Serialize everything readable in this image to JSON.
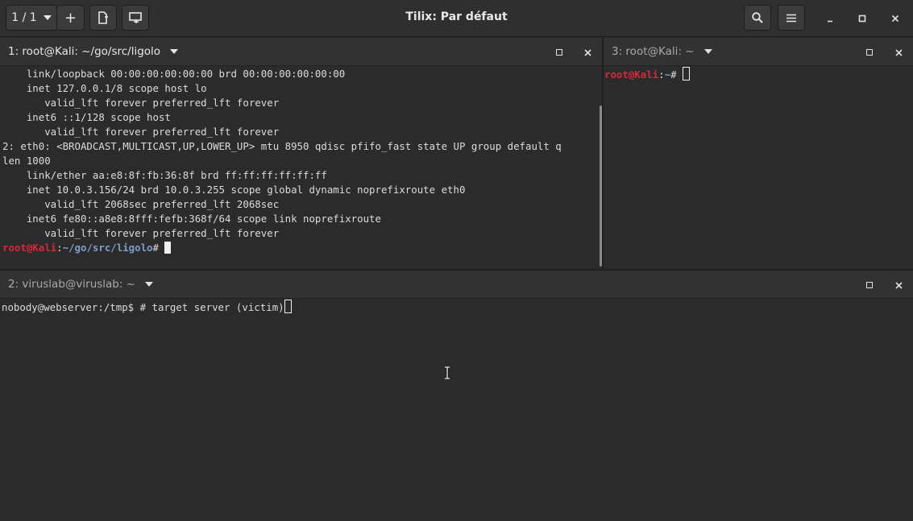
{
  "window": {
    "title": "Tilix: Par défaut",
    "session_counter": "1 / 1"
  },
  "panes": {
    "left_top": {
      "title": "1: root@Kali: ~/go/src/ligolo",
      "lines": [
        "    link/loopback 00:00:00:00:00:00 brd 00:00:00:00:00:00",
        "    inet 127.0.0.1/8 scope host lo",
        "       valid_lft forever preferred_lft forever",
        "    inet6 ::1/128 scope host",
        "       valid_lft forever preferred_lft forever",
        "2: eth0: <BROADCAST,MULTICAST,UP,LOWER_UP> mtu 8950 qdisc pfifo_fast state UP group default q",
        "len 1000",
        "    link/ether aa:e8:8f:fb:36:8f brd ff:ff:ff:ff:ff:ff",
        "    inet 10.0.3.156/24 brd 10.0.3.255 scope global dynamic noprefixroute eth0",
        "       valid_lft 2068sec preferred_lft 2068sec",
        "    inet6 fe80::a8e8:8fff:fefb:368f/64 scope link noprefixroute",
        "       valid_lft forever preferred_lft forever"
      ],
      "prompt": {
        "user": "root@Kali",
        "sep": ":",
        "path": "~/go/src/ligolo",
        "symbol": "#"
      }
    },
    "right_top": {
      "title": "3: root@Kali: ~",
      "prompt": {
        "user": "root@Kali",
        "sep": ":",
        "path": "~",
        "symbol": "#"
      }
    },
    "bottom": {
      "title": "2: viruslab@viruslab: ~",
      "command_line": "nobody@webserver:/tmp$ # target server (victim)"
    }
  },
  "colors": {
    "prompt_user": "#d8283b",
    "prompt_path": "#7e9ec8",
    "background": "#2b2b2b"
  }
}
